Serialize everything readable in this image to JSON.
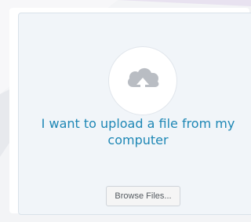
{
  "upload": {
    "prompt_text": "I want to upload a file from my computer",
    "browse_button_label": "Browse Files...",
    "icon": "cloud-upload-icon",
    "accent_color": "#1e87b5"
  }
}
